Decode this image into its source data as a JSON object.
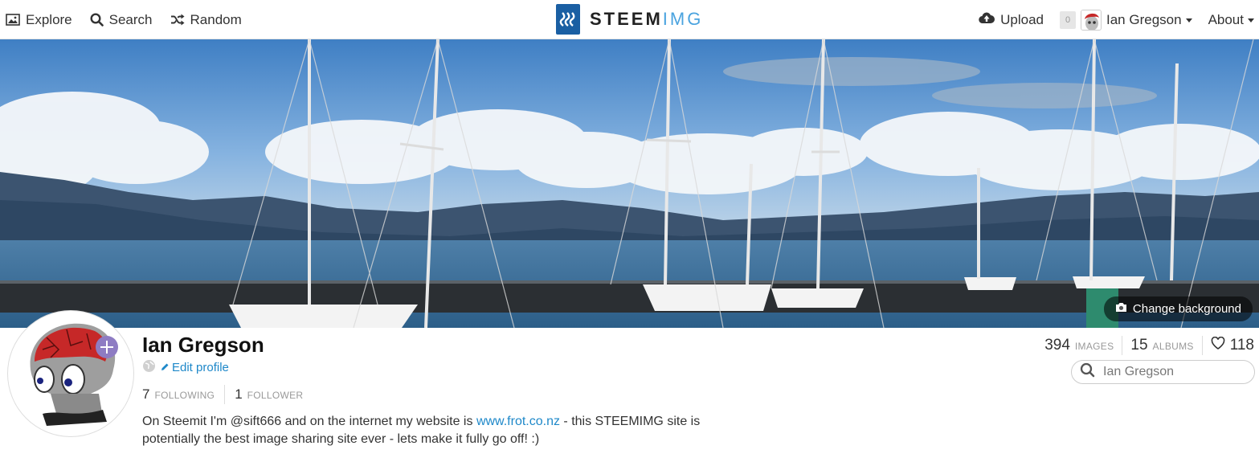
{
  "nav": {
    "explore": "Explore",
    "search": "Search",
    "random": "Random"
  },
  "brand": {
    "part1": "STEEM",
    "part2": "IMG"
  },
  "user_menu": {
    "upload": "Upload",
    "notification_count": "0",
    "username": "Ian Gregson",
    "about": "About"
  },
  "cover": {
    "change_background": "Change background"
  },
  "profile": {
    "name": "Ian Gregson",
    "edit_profile": "Edit profile",
    "following_count": "7",
    "following_label": "FOLLOWING",
    "followers_count": "1",
    "followers_label": "FOLLOWER",
    "bio_part1": "On Steemit I'm @sift666 and on the internet my website is ",
    "bio_link": "www.frot.co.nz",
    "bio_part2": " - this STEEMIMG site is potentially the best image sharing site ever - lets make it fully go off! :)"
  },
  "stats": {
    "images_count": "394",
    "images_label": "IMAGES",
    "albums_count": "15",
    "albums_label": "ALBUMS",
    "likes_count": "118"
  },
  "profile_search": {
    "value": "Ian Gregson"
  },
  "colors": {
    "accent": "#1e88c9",
    "brand_blue": "#1a5fa3",
    "brand_light": "#4aa3df"
  },
  "icons": [
    "image-icon",
    "search-icon",
    "shuffle-icon",
    "upload-cloud-icon",
    "camera-icon",
    "globe-icon",
    "pencil-icon",
    "heart-icon"
  ]
}
